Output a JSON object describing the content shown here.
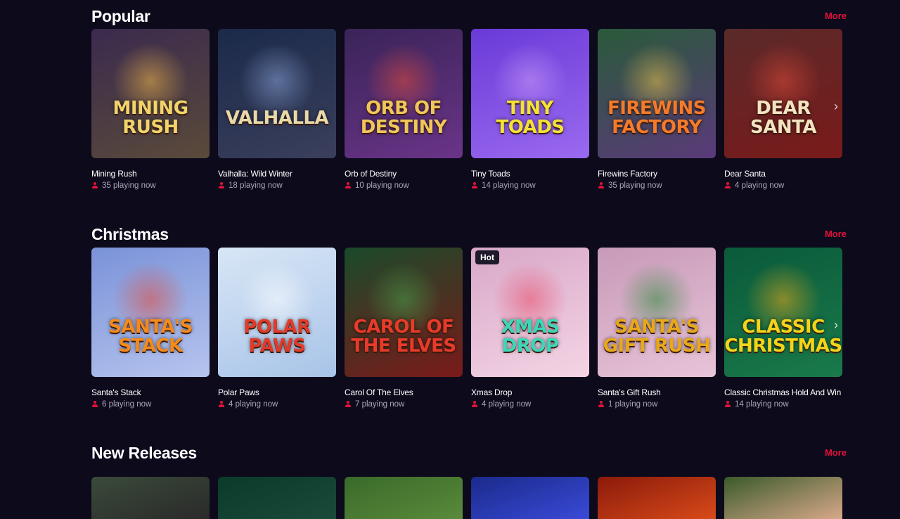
{
  "sections": [
    {
      "title": "Popular",
      "more": "More",
      "games": [
        {
          "name": "Mining Rush",
          "logo": "MINING RUSH",
          "players": "35 playing now",
          "colors": [
            "#3b2a4e",
            "#5a4a3a"
          ],
          "logo_color": "#f2d36b",
          "glow": "#f0b64a"
        },
        {
          "name": "Valhalla: Wild Winter",
          "logo": "VALHALLA",
          "players": "18 playing now",
          "colors": [
            "#1b2a4a",
            "#3a3f5c"
          ],
          "logo_color": "#e9d9a8",
          "glow": "#8aa4d8"
        },
        {
          "name": "Orb of Destiny",
          "logo": "ORB of DESTINY",
          "players": "10 playing now",
          "colors": [
            "#3a2458",
            "#6a3488"
          ],
          "logo_color": "#f0c65a",
          "glow": "#e04a3a"
        },
        {
          "name": "Tiny Toads",
          "logo": "TINY TOADS",
          "players": "14 playing now",
          "colors": [
            "#6a3ad8",
            "#9a6af0"
          ],
          "logo_color": "#f4e234",
          "glow": "#c79af7"
        },
        {
          "name": "Firewins Factory",
          "logo": "FIREWINS FACTORY",
          "players": "35 playing now",
          "colors": [
            "#2a5a3a",
            "#5a3a7a"
          ],
          "logo_color": "#f47a2a",
          "glow": "#e8c24a"
        },
        {
          "name": "Dear Santa",
          "logo": "Dear Santa",
          "players": "4 playing now",
          "colors": [
            "#5a2a2a",
            "#7a1a1a"
          ],
          "logo_color": "#f3e3c0",
          "glow": "#d84a3a"
        }
      ]
    },
    {
      "title": "Christmas",
      "more": "More",
      "games": [
        {
          "name": "Santa's Stack",
          "logo": "SANTA'S STACK",
          "players": "6 playing now",
          "colors": [
            "#7a92d8",
            "#b6c4ee"
          ],
          "logo_color": "#f48a1a",
          "glow": "#e34a3a"
        },
        {
          "name": "Polar Paws",
          "logo": "POLAR PAWS",
          "players": "4 playing now",
          "colors": [
            "#d8e6f6",
            "#a8c4e8"
          ],
          "logo_color": "#e23a2a",
          "glow": "#ffffff"
        },
        {
          "name": "Carol Of The Elves",
          "logo": "CAROL of the ELVES",
          "players": "7 playing now",
          "colors": [
            "#1a4a2a",
            "#7a1a1a"
          ],
          "logo_color": "#e83a2a",
          "glow": "#4aa04a"
        },
        {
          "name": "Xmas Drop",
          "logo": "Xmas Drop",
          "players": "4 playing now",
          "colors": [
            "#d8a8c8",
            "#f4d4e4"
          ],
          "logo_color": "#3ad8b8",
          "glow": "#e84a6a",
          "badge": "Hot"
        },
        {
          "name": "Santa's Gift Rush",
          "logo": "Santa's Gift Rush",
          "players": "1 playing now",
          "colors": [
            "#c89ab8",
            "#e8c4d8"
          ],
          "logo_color": "#e8a81a",
          "glow": "#2a8a3a"
        },
        {
          "name": "Classic Christmas Hold And Win",
          "logo": "CLASSIC CHRISTMAS",
          "players": "14 playing now",
          "colors": [
            "#0a5a3a",
            "#1a7a4a"
          ],
          "logo_color": "#f4d41a",
          "glow": "#e8a81a"
        }
      ]
    },
    {
      "title": "New Releases",
      "more": "More",
      "games": [
        {
          "colors": [
            "#3a4a3a",
            "#2a2a2a"
          ]
        },
        {
          "colors": [
            "#0a3a2a",
            "#1a4a3a"
          ]
        },
        {
          "colors": [
            "#3a6a2a",
            "#5a8a3a"
          ]
        },
        {
          "colors": [
            "#1a2a8a",
            "#3a4ad8"
          ]
        },
        {
          "colors": [
            "#8a1a0a",
            "#d84a1a"
          ]
        },
        {
          "colors": [
            "#3a5a2a",
            "#d8a88a"
          ]
        }
      ]
    }
  ]
}
